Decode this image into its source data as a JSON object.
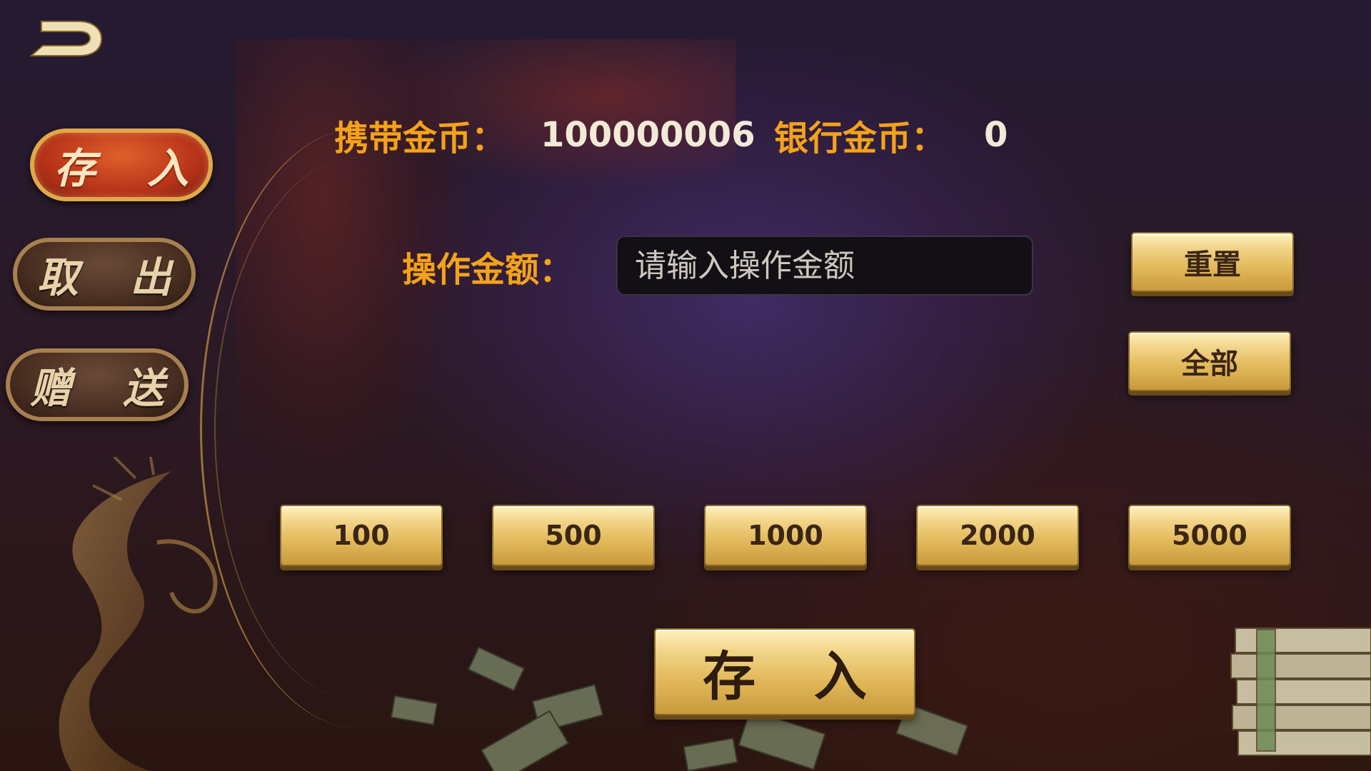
{
  "nav": {
    "back_icon": "back-arrow-icon"
  },
  "tabs": [
    {
      "label": "存 入",
      "active": true
    },
    {
      "label": "取 出",
      "active": false
    },
    {
      "label": "赠 送",
      "active": false
    }
  ],
  "info": {
    "carry_label": "携带金币：",
    "carry_value": "100000006",
    "bank_label": "银行金币：",
    "bank_value": "0"
  },
  "operation": {
    "label": "操作金额：",
    "input_value": "",
    "input_placeholder": "请输入操作金额",
    "reset_label": "重置",
    "all_label": "全部"
  },
  "quick_amounts": [
    "100",
    "500",
    "1000",
    "2000",
    "5000"
  ],
  "submit_label": "存 入",
  "colors": {
    "label_orange": "#f5a21b",
    "value_white": "#f2ead6",
    "gold_button": "#e2b95a",
    "active_tab": "#b8341a"
  }
}
